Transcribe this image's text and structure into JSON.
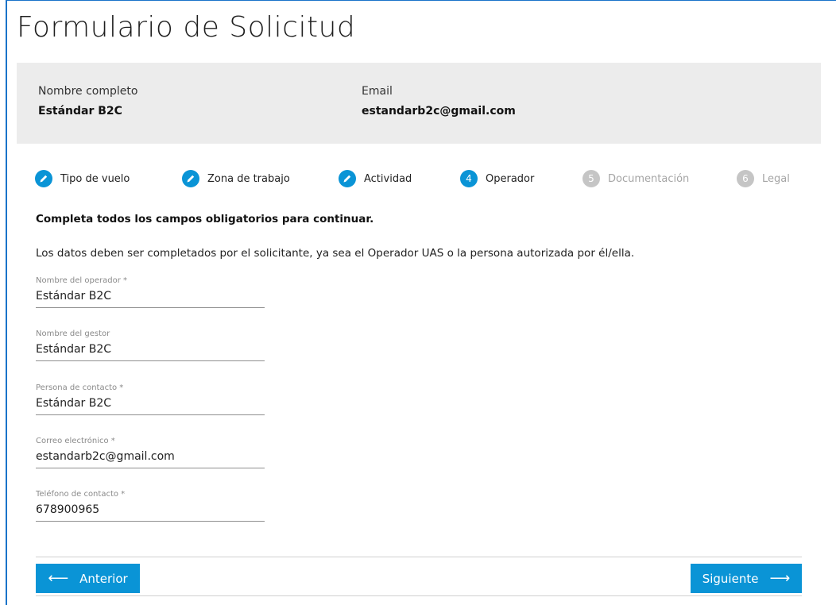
{
  "title": "Formulario de Solicitud",
  "user": {
    "name_label": "Nombre completo",
    "name_value": "Estándar B2C",
    "email_label": "Email",
    "email_value": "estandarb2c@gmail.com"
  },
  "steps": [
    {
      "label": "Tipo de vuelo",
      "state": "done",
      "number": "1"
    },
    {
      "label": "Zona de trabajo",
      "state": "done",
      "number": "2"
    },
    {
      "label": "Actividad",
      "state": "done",
      "number": "3"
    },
    {
      "label": "Operador",
      "state": "active",
      "number": "4"
    },
    {
      "label": "Documentación",
      "state": "pending",
      "number": "5"
    },
    {
      "label": "Legal",
      "state": "pending",
      "number": "6"
    }
  ],
  "instructions": {
    "required_note": "Completa todos los campos obligatorios para continuar.",
    "description": "Los datos deben ser completados por el solicitante, ya sea el Operador UAS o la persona autorizada por él/ella."
  },
  "fields": [
    {
      "label": "Nombre del operador *",
      "value": "Estándar B2C"
    },
    {
      "label": "Nombre del gestor",
      "value": "Estándar B2C"
    },
    {
      "label": "Persona de contacto *",
      "value": "Estándar B2C"
    },
    {
      "label": "Correo electrónico *",
      "value": "estandarb2c@gmail.com"
    },
    {
      "label": "Teléfono de contacto *",
      "value": "678900965"
    }
  ],
  "buttons": {
    "prev_label": "Anterior",
    "next_label": "Siguiente"
  },
  "colors": {
    "accent": "#0a94d6",
    "pending": "#c5c5c5",
    "panel": "#ececec"
  },
  "icons": {
    "done_step": "pencil-icon",
    "prev": "arrow-left-icon",
    "next": "arrow-right-icon"
  }
}
